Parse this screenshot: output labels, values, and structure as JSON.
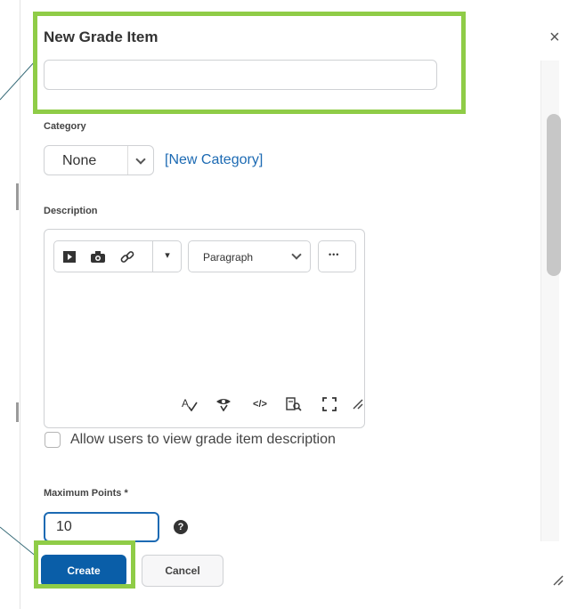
{
  "dialog": {
    "title": "New Grade Item",
    "close_glyph": "×",
    "name_input": {
      "value": "",
      "placeholder": ""
    }
  },
  "category": {
    "label": "Category",
    "selected": "None",
    "new_link": "[New Category]"
  },
  "description": {
    "label": "Description",
    "toolbar": {
      "insert_media_icon": "▶",
      "insert_image_icon": "camera-icon",
      "insert_link_icon": "link-icon",
      "more_dropdown_icon": "▾",
      "format_selected": "Paragraph",
      "more_options_glyph": "•••"
    },
    "footer_icons": [
      "spellcheck-icon",
      "accessibility-icon",
      "source-code-icon",
      "preview-icon",
      "fullscreen-icon",
      "resize-icon"
    ]
  },
  "allow_view": {
    "label": "Allow users to view grade item description",
    "checked": false
  },
  "max_points": {
    "label": "Maximum Points *",
    "value": "10",
    "help_glyph": "?"
  },
  "actions": {
    "create": "Create",
    "cancel": "Cancel"
  },
  "colors": {
    "accent": "#1c6ab3",
    "primary_button": "#0a5ea8",
    "highlight": "#8fcc47"
  }
}
